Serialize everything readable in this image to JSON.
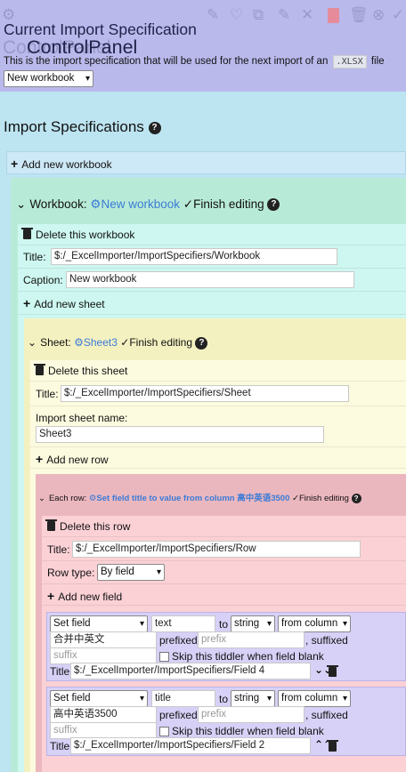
{
  "header": {
    "title": "Current Import Specification",
    "control_panel": "ControlPanel",
    "ghost_control_panel": "ControlPanel",
    "desc_before": "This is the import specification that will be used for the next import of an",
    "desc_code": ".XLSX",
    "desc_after": "file",
    "current_spec": "New workbook"
  },
  "specs": {
    "title": "Import Specifications",
    "add_workbook": "Add new workbook",
    "workbook": {
      "prefix": "Workbook:",
      "name": "New workbook",
      "finish": "Finish editing",
      "delete": "Delete this workbook",
      "title_label": "Title:",
      "title_value": "$:/_ExcelImporter/ImportSpecifiers/Workbook",
      "caption_label": "Caption:",
      "caption_value": "New workbook",
      "add_sheet": "Add new sheet"
    },
    "sheet": {
      "prefix": "Sheet:",
      "name": "Sheet3",
      "finish": "Finish editing",
      "delete": "Delete this sheet",
      "title_label": "Title:",
      "title_value": "$:/_ExcelImporter/ImportSpecifiers/Sheet",
      "import_name_label": "Import sheet name:",
      "import_name_value": "Sheet3",
      "add_row": "Add new row"
    },
    "row": {
      "prefix": "Each row:",
      "name": "Set field title to value from column 高中英语3500",
      "finish": "Finish editing",
      "delete": "Delete this row",
      "title_label": "Title:",
      "title_value": "$:/_ExcelImporter/ImportSpecifiers/Row",
      "type_label": "Row type:",
      "type_value": "By field",
      "add_field": "Add new field"
    },
    "fields": [
      {
        "action": "Set field",
        "field": "text",
        "to": "to",
        "type": "string",
        "source": "from column",
        "column": "合并中英文",
        "prefixed": "prefixed",
        "prefix_ph": "prefix",
        "suffixed": ", suffixed",
        "suffix_ph": "suffix",
        "skip": "Skip this tiddler when field blank",
        "title_label": "Title:",
        "title_value": "$:/_ExcelImporter/ImportSpecifiers/Field 4"
      },
      {
        "action": "Set field",
        "field": "title",
        "to": "to",
        "type": "string",
        "source": "from column",
        "column": "高中英语3500",
        "prefixed": "prefixed",
        "prefix_ph": "prefix",
        "suffixed": ", suffixed",
        "suffix_ph": "suffix",
        "skip": "Skip this tiddler when field blank",
        "title_label": "Title:",
        "title_value": "$:/_ExcelImporter/ImportSpecifiers/Field 2"
      }
    ]
  },
  "colors": {
    "header_bg": "#b9b9ec",
    "specs_bg": "#bde4f1",
    "workbook_bg": "#b8ebd7",
    "workbook_inner": "#cdf7f0",
    "sheet_bg": "#f4f1c1",
    "sheet_inner": "#fcfbdf",
    "row_bg": "#ebb7bf",
    "row_inner": "#fbd1d6",
    "field_bg": "#d7d1f7",
    "link": "#3b7bd6"
  }
}
